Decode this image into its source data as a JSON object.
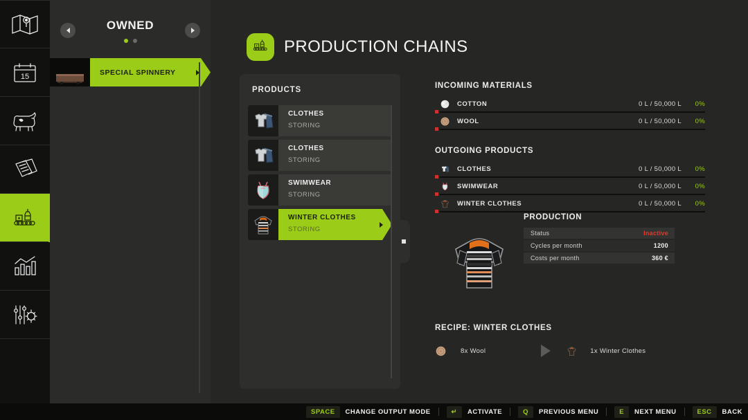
{
  "sidebar_rail": {
    "items": [
      {
        "name": "map",
        "icon": "map-icon",
        "active": false
      },
      {
        "name": "calendar",
        "icon": "calendar-icon",
        "label": "15",
        "active": false
      },
      {
        "name": "animals",
        "icon": "cow-icon",
        "active": false
      },
      {
        "name": "contracts",
        "icon": "documents-icon",
        "active": false
      },
      {
        "name": "production",
        "icon": "factory-icon",
        "active": true
      },
      {
        "name": "statistics",
        "icon": "bar-chart-icon",
        "active": false
      },
      {
        "name": "settings",
        "icon": "sliders-gear-icon",
        "active": false
      }
    ]
  },
  "owned": {
    "title": "OWNED",
    "prev_label": "previous",
    "next_label": "next",
    "page_dots": 2,
    "active_dot": 0,
    "items": [
      {
        "label": "SPECIAL SPINNERY",
        "selected": true
      }
    ]
  },
  "header": {
    "title": "PRODUCTION CHAINS",
    "logo_icon": "factory-icon"
  },
  "products_panel": {
    "title": "PRODUCTS",
    "items": [
      {
        "name": "CLOTHES",
        "state": "STORING",
        "icon": "clothes-icon",
        "selected": false
      },
      {
        "name": "CLOTHES",
        "state": "STORING",
        "icon": "clothes-icon",
        "selected": false
      },
      {
        "name": "SWIMWEAR",
        "state": "STORING",
        "icon": "swimwear-icon",
        "selected": false
      },
      {
        "name": "WINTER CLOTHES",
        "state": "STORING",
        "icon": "winter-clothes-icon",
        "selected": true
      }
    ]
  },
  "incoming": {
    "title": "INCOMING MATERIALS",
    "items": [
      {
        "name": "COTTON",
        "amount": "0 L / 50,000 L",
        "percent": "0%",
        "fill": 0,
        "icon": "cotton-icon"
      },
      {
        "name": "WOOL",
        "amount": "0 L / 50,000 L",
        "percent": "0%",
        "fill": 0,
        "icon": "wool-icon"
      }
    ]
  },
  "outgoing": {
    "title": "OUTGOING PRODUCTS",
    "items": [
      {
        "name": "CLOTHES",
        "amount": "0 L / 50,000 L",
        "percent": "0%",
        "fill": 0,
        "icon": "clothes-icon"
      },
      {
        "name": "SWIMWEAR",
        "amount": "0 L / 50,000 L",
        "percent": "0%",
        "fill": 0,
        "icon": "swimwear-icon"
      },
      {
        "name": "WINTER CLOTHES",
        "amount": "0 L / 50,000 L",
        "percent": "0%",
        "fill": 0,
        "icon": "winter-clothes-icon"
      }
    ]
  },
  "production": {
    "title": "PRODUCTION",
    "image_icon": "winter-sweater-image",
    "rows": [
      {
        "key": "Status",
        "value": "Inactive",
        "status": "bad"
      },
      {
        "key": "Cycles per month",
        "value": "1200",
        "status": ""
      },
      {
        "key": "Costs per month",
        "value": "360 €",
        "status": ""
      }
    ]
  },
  "recipe": {
    "title": "RECIPE: WINTER CLOTHES",
    "input": {
      "text": "8x Wool",
      "icon": "wool-icon"
    },
    "output": {
      "text": "1x Winter Clothes",
      "icon": "winter-clothes-icon"
    }
  },
  "bottom_bar": {
    "hints": [
      {
        "key": "SPACE",
        "label": "CHANGE OUTPUT MODE"
      },
      {
        "key": "↵",
        "label": "ACTIVATE"
      },
      {
        "key": "Q",
        "label": "PREVIOUS MENU"
      },
      {
        "key": "E",
        "label": "NEXT MENU"
      },
      {
        "key": "ESC",
        "label": "BACK"
      }
    ]
  },
  "colors": {
    "accent_green": "#9bcc18",
    "status_bad": "#e03a2f",
    "marker_red": "#cf3030",
    "panel_bg": "#2e2f2c",
    "app_bg": "#262724"
  }
}
